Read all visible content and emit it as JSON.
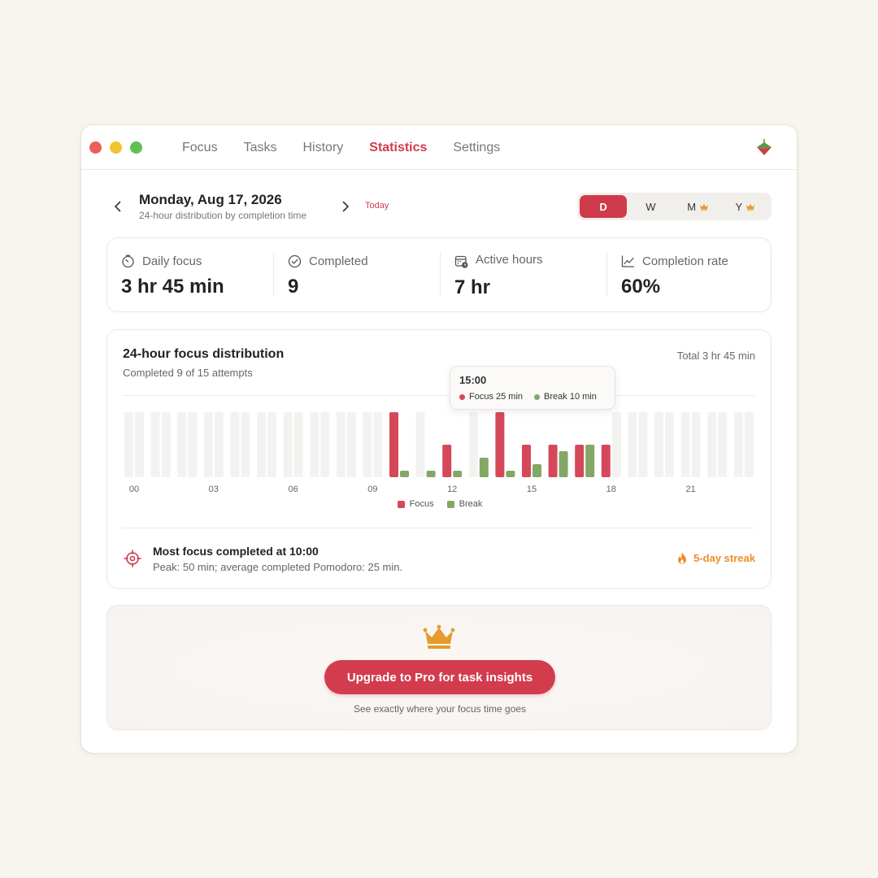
{
  "nav": {
    "items": [
      {
        "label": "Focus",
        "active": false
      },
      {
        "label": "Tasks",
        "active": false
      },
      {
        "label": "History",
        "active": false
      },
      {
        "label": "Statistics",
        "active": true
      },
      {
        "label": "Settings",
        "active": false
      }
    ]
  },
  "date_header": {
    "title": "Monday, Aug 17, 2026",
    "subtitle": "24-hour distribution by completion time",
    "today_label": "Today"
  },
  "period_selector": {
    "options": [
      {
        "label": "D",
        "active": true,
        "pro": false
      },
      {
        "label": "W",
        "active": false,
        "pro": false
      },
      {
        "label": "M",
        "active": false,
        "pro": true
      },
      {
        "label": "Y",
        "active": false,
        "pro": true
      }
    ]
  },
  "stats": [
    {
      "label": "Daily focus",
      "value": "3 hr 45 min",
      "icon": "timer-icon"
    },
    {
      "label": "Completed",
      "value": "9",
      "icon": "check-circle-icon"
    },
    {
      "label": "Active hours",
      "value": "7 hr",
      "icon": "calendar-clock-icon"
    },
    {
      "label": "Completion rate",
      "value": "60%",
      "icon": "trend-chart-icon"
    }
  ],
  "distribution": {
    "title": "24-hour focus distribution",
    "subtitle": "Completed 9 of 15 attempts",
    "total": "Total 3 hr 45 min",
    "tooltip": {
      "time": "15:00",
      "focus": "Focus 25 min",
      "break": "Break 10 min"
    },
    "legend": {
      "focus": "Focus",
      "break": "Break"
    },
    "insight_title": "Most focus completed at 10:00",
    "insight_sub": "Peak: 50 min; average completed Pomodoro: 25 min.",
    "streak": "5-day streak"
  },
  "chart_data": {
    "type": "bar",
    "categories": [
      "00",
      "01",
      "02",
      "03",
      "04",
      "05",
      "06",
      "07",
      "08",
      "09",
      "10",
      "11",
      "12",
      "13",
      "14",
      "15",
      "16",
      "17",
      "18",
      "19",
      "20",
      "21",
      "22",
      "23"
    ],
    "tick_labels": [
      "00",
      "03",
      "06",
      "09",
      "12",
      "15",
      "18",
      "21"
    ],
    "series": [
      {
        "name": "Focus",
        "color": "#d5485a",
        "values": [
          0,
          0,
          0,
          0,
          0,
          0,
          0,
          0,
          0,
          0,
          50,
          0,
          25,
          0,
          50,
          25,
          25,
          25,
          25,
          0,
          0,
          0,
          0,
          0
        ]
      },
      {
        "name": "Break",
        "color": "#84a766",
        "values": [
          0,
          0,
          0,
          0,
          0,
          0,
          0,
          0,
          0,
          0,
          5,
          5,
          5,
          15,
          5,
          10,
          20,
          25,
          0,
          0,
          0,
          0,
          0,
          0
        ]
      }
    ],
    "ylim": [
      0,
      50
    ],
    "grid": false,
    "legend_position": "bottom-center"
  },
  "upgrade": {
    "button_label": "Upgrade to Pro for task insights",
    "subtitle": "See exactly where your focus time goes"
  },
  "colors": {
    "accent": "#cf3b4b",
    "focus": "#d5485a",
    "break": "#84a766",
    "streak": "#ee8c2c",
    "crown": "#e59c2c"
  }
}
